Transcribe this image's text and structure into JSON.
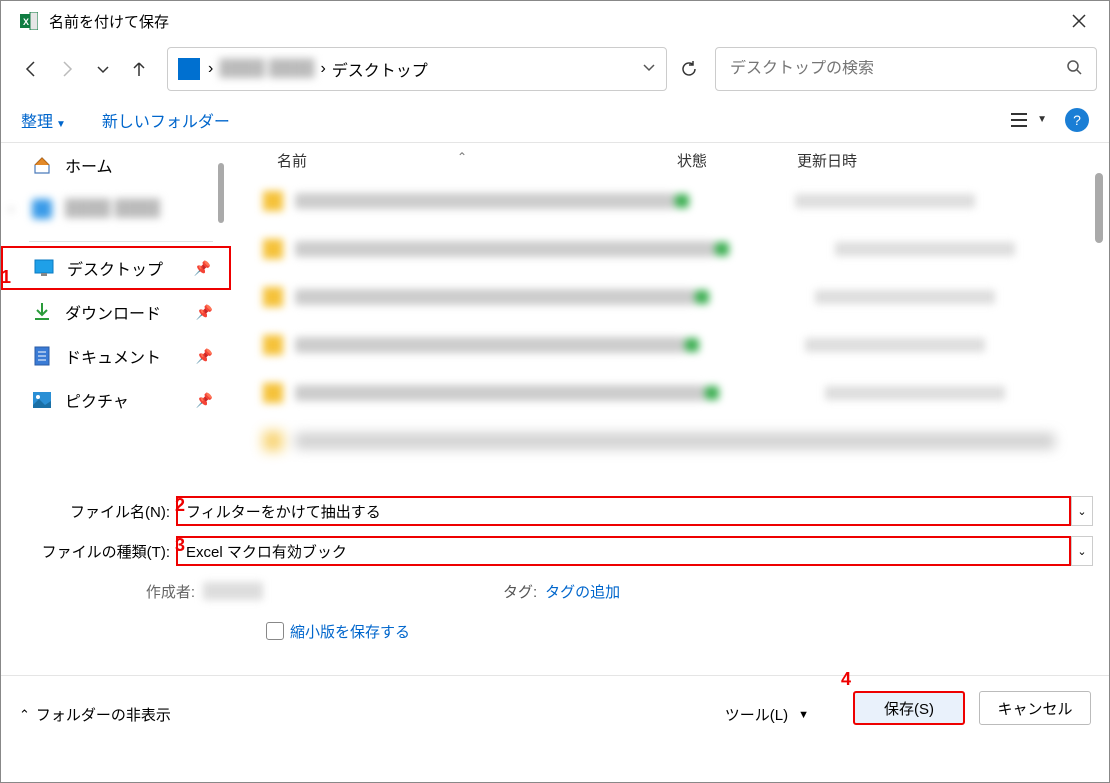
{
  "window": {
    "title": "名前を付けて保存"
  },
  "breadcrumb": {
    "blurred": "████ ████",
    "sep": "›",
    "current": "デスクトップ"
  },
  "search": {
    "placeholder": "デスクトップの検索"
  },
  "toolbar": {
    "organize": "整理",
    "new_folder": "新しいフォルダー"
  },
  "sidebar": {
    "home": "ホーム",
    "blurred": "████ ████",
    "desktop": "デスクトップ",
    "downloads": "ダウンロード",
    "documents": "ドキュメント",
    "pictures": "ピクチャ"
  },
  "columns": {
    "name": "名前",
    "status": "状態",
    "date": "更新日時"
  },
  "form": {
    "filename_label": "ファイル名(N):",
    "filetype_label": "ファイルの種類(T):",
    "filename_value": "フィルターをかけて抽出する",
    "filetype_value": "Excel マクロ有効ブック",
    "author_label": "作成者:",
    "tag_label": "タグ:",
    "tag_link": "タグの追加",
    "thumbnail": "縮小版を保存する"
  },
  "footer": {
    "hide_folders": "フォルダーの非表示",
    "tools": "ツール(L)",
    "save": "保存(S)",
    "cancel": "キャンセル"
  },
  "markers": {
    "m1": "1",
    "m2": "2",
    "m3": "3",
    "m4": "4"
  }
}
